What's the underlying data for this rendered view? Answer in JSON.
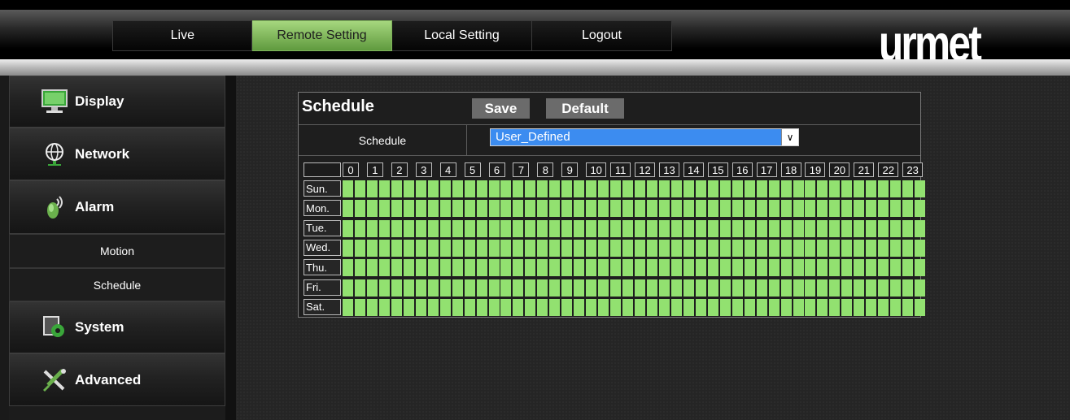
{
  "nav": {
    "tabs": [
      {
        "label": "Live",
        "active": false
      },
      {
        "label": "Remote Setting",
        "active": true
      },
      {
        "label": "Local Setting",
        "active": false
      },
      {
        "label": "Logout",
        "active": false
      }
    ]
  },
  "brand": {
    "logo_text": "urmet"
  },
  "sidebar": {
    "display": "Display",
    "network": "Network",
    "alarm": "Alarm",
    "motion": "Motion",
    "schedule": "Schedule",
    "system": "System",
    "advanced": "Advanced"
  },
  "panel": {
    "title": "Schedule",
    "save_label": "Save",
    "default_label": "Default",
    "schedule_label": "Schedule",
    "schedule_value": "User_Defined"
  },
  "grid": {
    "hours": [
      "0",
      "1",
      "2",
      "3",
      "4",
      "5",
      "6",
      "7",
      "8",
      "9",
      "10",
      "11",
      "12",
      "13",
      "14",
      "15",
      "16",
      "17",
      "18",
      "19",
      "20",
      "21",
      "22",
      "23"
    ],
    "days": [
      "Sun.",
      "Mon.",
      "Tue.",
      "Wed.",
      "Thu.",
      "Fri.",
      "Sat."
    ],
    "all_slots_enabled": true
  },
  "colors": {
    "active_tab": "#8cc364",
    "slot_enabled": "#92e170",
    "select_bg": "#3c8cf0"
  }
}
